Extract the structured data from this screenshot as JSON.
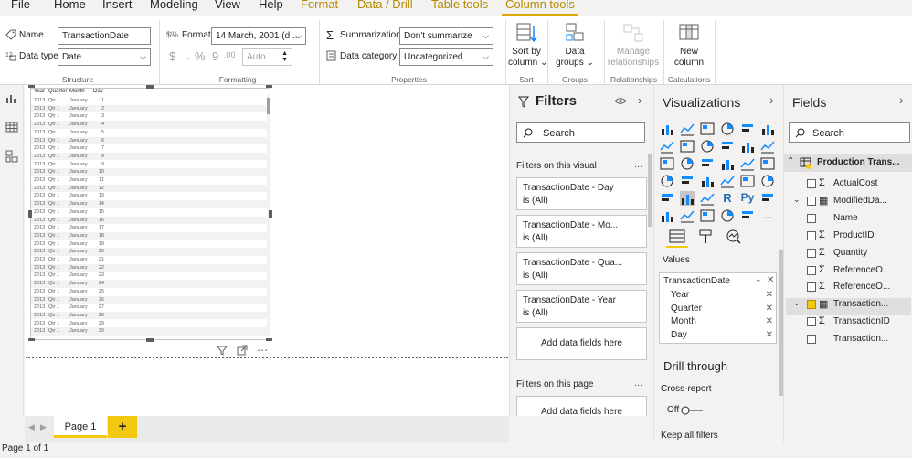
{
  "menu": {
    "items": [
      "File",
      "Home",
      "Insert",
      "Modeling",
      "View",
      "Help"
    ],
    "context_tabs": [
      "Format",
      "Data / Drill",
      "Table tools",
      "Column tools"
    ],
    "active_tab": "Column tools"
  },
  "ribbon": {
    "structure": {
      "name_label": "Name",
      "name_value": "TransactionDate",
      "datatype_label": "Data type",
      "datatype_value": "Date",
      "group_label": "Structure"
    },
    "formatting": {
      "format_label": "Format",
      "format_value": "14 March, 2001 (d ...",
      "currency_symbol": "$",
      "percent_symbol": "%",
      "comma_symbol": "9",
      "decimal_symbol": ".00",
      "auto_value": "Auto",
      "group_label": "Formatting"
    },
    "properties": {
      "summarization_label": "Summarization",
      "summarization_value": "Don't summarize",
      "category_label": "Data category",
      "category_value": "Uncategorized",
      "group_label": "Properties"
    },
    "sort": {
      "label_line1": "Sort by",
      "label_line2": "column",
      "group_label": "Sort"
    },
    "groups": {
      "label_line1": "Data",
      "label_line2": "groups",
      "group_label": "Groups"
    },
    "relationships": {
      "label_line1": "Manage",
      "label_line2": "relationships",
      "group_label": "Relationships"
    },
    "calculations": {
      "label_line1": "New",
      "label_line2": "column",
      "group_label": "Calculations"
    }
  },
  "table_visual": {
    "headers": [
      "Year",
      "Quarter",
      "Month",
      "Day"
    ],
    "rows": [
      [
        "2013",
        "Qtr 1",
        "January",
        "1"
      ],
      [
        "2013",
        "Qtr 1",
        "January",
        "2"
      ],
      [
        "2013",
        "Qtr 1",
        "January",
        "3"
      ],
      [
        "2013",
        "Qtr 1",
        "January",
        "4"
      ],
      [
        "2013",
        "Qtr 1",
        "January",
        "5"
      ],
      [
        "2013",
        "Qtr 1",
        "January",
        "6"
      ],
      [
        "2013",
        "Qtr 1",
        "January",
        "7"
      ],
      [
        "2013",
        "Qtr 1",
        "January",
        "8"
      ],
      [
        "2013",
        "Qtr 1",
        "January",
        "9"
      ],
      [
        "2013",
        "Qtr 1",
        "January",
        "10"
      ],
      [
        "2013",
        "Qtr 1",
        "January",
        "11"
      ],
      [
        "2013",
        "Qtr 1",
        "January",
        "12"
      ],
      [
        "2013",
        "Qtr 1",
        "January",
        "13"
      ],
      [
        "2013",
        "Qtr 1",
        "January",
        "14"
      ],
      [
        "2013",
        "Qtr 1",
        "January",
        "15"
      ],
      [
        "2013",
        "Qtr 1",
        "January",
        "16"
      ],
      [
        "2013",
        "Qtr 1",
        "January",
        "17"
      ],
      [
        "2013",
        "Qtr 1",
        "January",
        "18"
      ],
      [
        "2013",
        "Qtr 1",
        "January",
        "19"
      ],
      [
        "2013",
        "Qtr 1",
        "January",
        "20"
      ],
      [
        "2013",
        "Qtr 1",
        "January",
        "21"
      ],
      [
        "2013",
        "Qtr 1",
        "January",
        "22"
      ],
      [
        "2013",
        "Qtr 1",
        "January",
        "23"
      ],
      [
        "2013",
        "Qtr 1",
        "January",
        "24"
      ],
      [
        "2013",
        "Qtr 1",
        "January",
        "25"
      ],
      [
        "2013",
        "Qtr 1",
        "January",
        "26"
      ],
      [
        "2013",
        "Qtr 1",
        "January",
        "27"
      ],
      [
        "2013",
        "Qtr 1",
        "January",
        "28"
      ],
      [
        "2013",
        "Qtr 1",
        "January",
        "29"
      ],
      [
        "2013",
        "Qtr 1",
        "January",
        "30"
      ]
    ]
  },
  "filters": {
    "title": "Filters",
    "search_placeholder": "Search",
    "on_visual_label": "Filters on this visual",
    "more": "...",
    "cards": [
      {
        "title": "TransactionDate - Day",
        "value": "is (All)"
      },
      {
        "title": "TransactionDate - Mo...",
        "value": "is (All)"
      },
      {
        "title": "TransactionDate - Qua...",
        "value": "is (All)"
      },
      {
        "title": "TransactionDate - Year",
        "value": "is (All)"
      }
    ],
    "add_fields": "Add data fields here",
    "on_page_label": "Filters on this page",
    "add_fields_page": "Add data fields here"
  },
  "visualizations": {
    "title": "Visualizations",
    "values_label": "Values",
    "field_title": "TransactionDate",
    "wells": [
      "Year",
      "Quarter",
      "Month",
      "Day"
    ],
    "drill_through": "Drill through",
    "cross_report": "Cross-report",
    "off_label": "Off",
    "keep_filters": "Keep all filters",
    "r_label": "R",
    "py_label": "Py",
    "more": "..."
  },
  "fields": {
    "title": "Fields",
    "search_placeholder": "Search",
    "table_name": "Production Trans...",
    "items": [
      {
        "name": "ActualCost",
        "sigma": true
      },
      {
        "name": "ModifiedDa...",
        "sigma": false
      },
      {
        "name": "Name",
        "sigma": false
      },
      {
        "name": "ProductID",
        "sigma": true
      },
      {
        "name": "Quantity",
        "sigma": true
      },
      {
        "name": "ReferenceO...",
        "sigma": true
      },
      {
        "name": "ReferenceO...",
        "sigma": true
      },
      {
        "name": "Transaction...",
        "sigma": false
      },
      {
        "name": "TransactionID",
        "sigma": true
      },
      {
        "name": "Transaction...",
        "sigma": false
      }
    ]
  },
  "pages": {
    "tabs": [
      "Page 1"
    ],
    "add_label": "+"
  },
  "status": {
    "text": "Page 1 of 1"
  },
  "colors": {
    "accent": "#f2c811",
    "context": "#b58a00"
  }
}
